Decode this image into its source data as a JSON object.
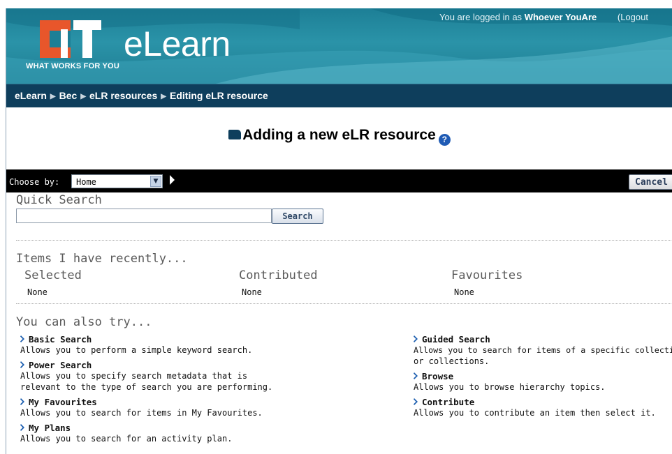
{
  "header": {
    "logo_text": "CIT",
    "tagline": "WHAT WORKS FOR YOU",
    "brand": "eLearn",
    "login_prefix": "You are logged in as",
    "user_name": "Whoever YouAre",
    "logout_label": "(Logout"
  },
  "breadcrumb": [
    "eLearn",
    "Bec",
    "eLR resources",
    "Editing eLR resource"
  ],
  "page": {
    "title": "Adding a new eLR resource",
    "help_glyph": "?"
  },
  "toolbar": {
    "choose_label": "Choose by:",
    "selected_option": "Home",
    "cancel_label": "Cancel"
  },
  "quick_search": {
    "heading": "Quick Search",
    "value": "",
    "button": "Search"
  },
  "recent": {
    "heading": "Items I have recently...",
    "columns": [
      {
        "title": "Selected",
        "value": "None"
      },
      {
        "title": "Contributed",
        "value": "None"
      },
      {
        "title": "Favourites",
        "value": "None"
      }
    ]
  },
  "try": {
    "heading": "You can also try...",
    "left": [
      {
        "title": "Basic Search",
        "desc": [
          "Allows you to perform a simple keyword search."
        ]
      },
      {
        "title": "Power Search",
        "desc": [
          "Allows you to specify search metadata that is",
          "relevant to the type of search you are performing."
        ]
      },
      {
        "title": "My Favourites",
        "desc": [
          "Allows you to search for items in My Favourites."
        ]
      },
      {
        "title": "My Plans",
        "desc": [
          "Allows you to search for an activity plan."
        ]
      }
    ],
    "right": [
      {
        "title": "Guided Search",
        "desc": [
          "Allows you to search for items of a specific collection",
          "or collections."
        ]
      },
      {
        "title": "Browse",
        "desc": [
          "Allows you to browse hierarchy topics."
        ]
      },
      {
        "title": "Contribute",
        "desc": [
          "Allows you to contribute an item then select it."
        ]
      }
    ]
  },
  "colors": {
    "banner": "#1d7f96",
    "breadcrumb_bg": "#0e3e5c",
    "logo_orange": "#e8562b",
    "chevron_blue": "#1d5fb0"
  }
}
